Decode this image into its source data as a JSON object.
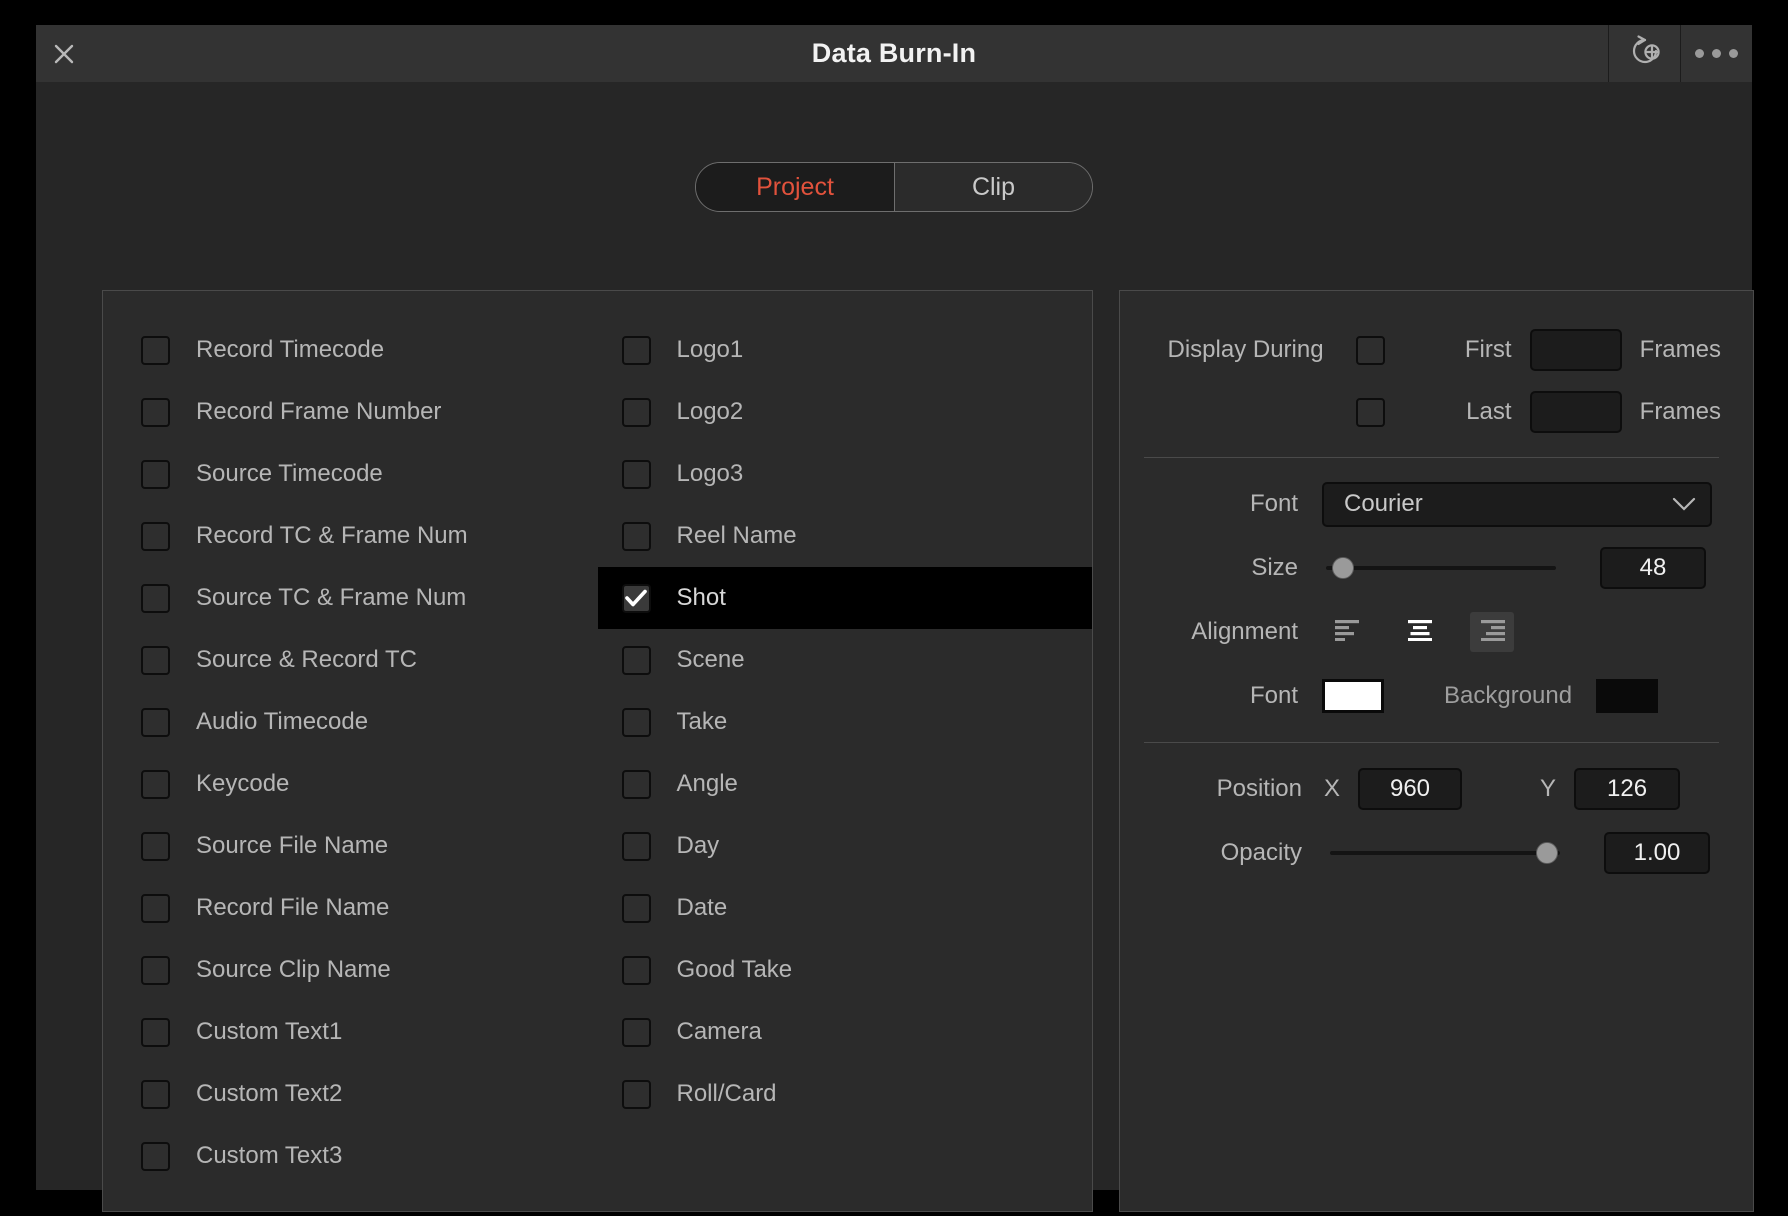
{
  "window": {
    "title": "Data Burn-In",
    "close_icon": "close-icon",
    "reset_icon": "reset-add-icon",
    "more_icon": "more-options-icon"
  },
  "tabs": [
    {
      "label": "Project",
      "active": true
    },
    {
      "label": "Clip",
      "active": false
    }
  ],
  "burnin_items": {
    "left_column": [
      {
        "label": "Record Timecode",
        "checked": false
      },
      {
        "label": "Record Frame Number",
        "checked": false
      },
      {
        "label": "Source Timecode",
        "checked": false
      },
      {
        "label": "Record TC & Frame Num",
        "checked": false
      },
      {
        "label": "Source TC & Frame Num",
        "checked": false
      },
      {
        "label": "Source & Record TC",
        "checked": false
      },
      {
        "label": "Audio Timecode",
        "checked": false
      },
      {
        "label": "Keycode",
        "checked": false
      },
      {
        "label": "Source File Name",
        "checked": false
      },
      {
        "label": "Record File Name",
        "checked": false
      },
      {
        "label": "Source Clip Name",
        "checked": false
      },
      {
        "label": "Custom Text1",
        "checked": false
      },
      {
        "label": "Custom Text2",
        "checked": false
      },
      {
        "label": "Custom Text3",
        "checked": false
      }
    ],
    "right_column": [
      {
        "label": "Logo1",
        "checked": false,
        "selected": false
      },
      {
        "label": "Logo2",
        "checked": false,
        "selected": false
      },
      {
        "label": "Logo3",
        "checked": false,
        "selected": false
      },
      {
        "label": "Reel Name",
        "checked": false,
        "selected": false
      },
      {
        "label": "Shot",
        "checked": true,
        "selected": true
      },
      {
        "label": "Scene",
        "checked": false,
        "selected": false
      },
      {
        "label": "Take",
        "checked": false,
        "selected": false
      },
      {
        "label": "Angle",
        "checked": false,
        "selected": false
      },
      {
        "label": "Day",
        "checked": false,
        "selected": false
      },
      {
        "label": "Date",
        "checked": false,
        "selected": false
      },
      {
        "label": "Good Take",
        "checked": false,
        "selected": false
      },
      {
        "label": "Camera",
        "checked": false,
        "selected": false
      },
      {
        "label": "Roll/Card",
        "checked": false,
        "selected": false
      }
    ]
  },
  "settings": {
    "display_during": {
      "label": "Display During",
      "first_label": "First",
      "first_value": "",
      "first_unit": "Frames",
      "first_checked": false,
      "last_label": "Last",
      "last_value": "",
      "last_unit": "Frames",
      "last_checked": false
    },
    "font": {
      "label": "Font",
      "value": "Courier",
      "chevron_icon": "chevron-down-icon"
    },
    "size": {
      "label": "Size",
      "value": "48",
      "slider_percent": 3
    },
    "alignment": {
      "label": "Alignment",
      "options": [
        "align-left",
        "align-center",
        "align-right"
      ],
      "selected": "align-center"
    },
    "colors": {
      "font_label": "Font",
      "font_color": "#ffffff",
      "background_label": "Background",
      "background_color": "#0a0a0a"
    },
    "position": {
      "label": "Position",
      "x_label": "X",
      "x_value": "960",
      "y_label": "Y",
      "y_value": "126"
    },
    "opacity": {
      "label": "Opacity",
      "value": "1.00",
      "slider_percent": 100
    }
  }
}
